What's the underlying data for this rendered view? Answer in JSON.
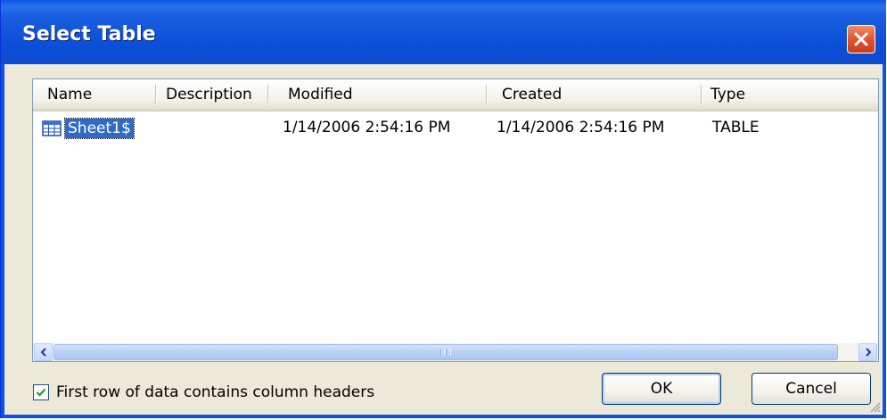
{
  "window": {
    "title": "Select Table"
  },
  "listview": {
    "columns": [
      {
        "label": "Name"
      },
      {
        "label": "Description"
      },
      {
        "label": "Modified"
      },
      {
        "label": "Created"
      },
      {
        "label": "Type"
      }
    ],
    "rows": [
      {
        "icon": "table-icon",
        "name": "Sheet1$",
        "description": "",
        "modified": "1/14/2006 2:54:16 PM",
        "created": "1/14/2006 2:54:16 PM",
        "type": "TABLE",
        "selected": true
      }
    ]
  },
  "options": {
    "first_row_headers_label": "First row of data contains column headers",
    "first_row_headers_checked": true
  },
  "buttons": {
    "ok_label": "OK",
    "cancel_label": "Cancel"
  },
  "colors": {
    "titlebar": "#0a54e4",
    "selection": "#316ac5",
    "close": "#e0552e"
  }
}
